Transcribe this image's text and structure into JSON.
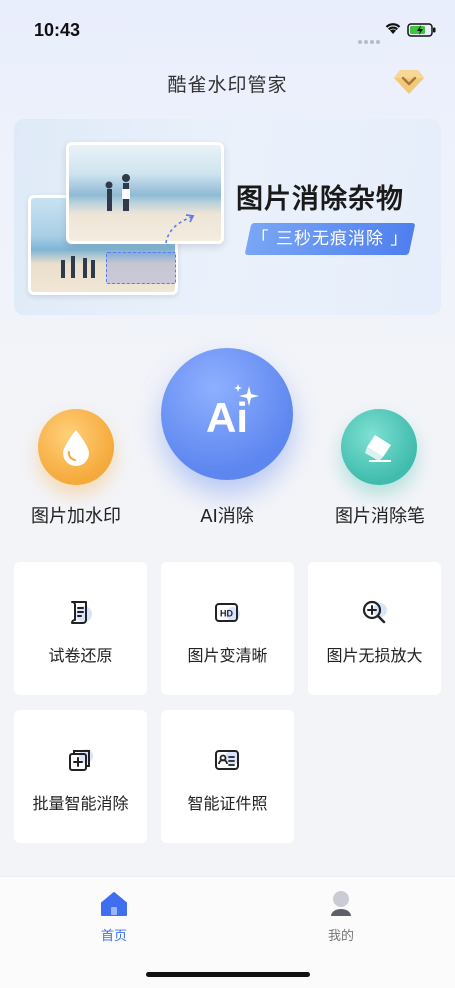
{
  "status_bar": {
    "time": "10:43"
  },
  "header": {
    "title": "酷雀水印管家",
    "vip_icon": "diamond-crown-icon"
  },
  "banner": {
    "title": "图片消除杂物",
    "subtitle": "「 三秒无痕消除 」"
  },
  "tools": [
    {
      "label": "图片加水印",
      "icon": "water-drop-icon",
      "color": "#f5a93a"
    },
    {
      "label": "AI消除",
      "icon_text": "Ai",
      "icon": "ai-sparkle-icon",
      "color": "#5d86ef"
    },
    {
      "label": "图片消除笔",
      "icon": "eraser-icon",
      "color": "#3fbcad"
    }
  ],
  "cards": [
    {
      "label": "试卷还原",
      "icon": "document-icon"
    },
    {
      "label": "图片变清晰",
      "icon": "hd-icon"
    },
    {
      "label": "图片无损放大",
      "icon": "zoom-in-icon"
    },
    {
      "label": "批量智能消除",
      "icon": "batch-add-icon"
    },
    {
      "label": "智能证件照",
      "icon": "id-card-icon"
    }
  ],
  "tab_bar": {
    "tabs": [
      {
        "label": "首页",
        "active": true,
        "color": "#3f6ef0"
      },
      {
        "label": "我的",
        "active": false,
        "color": "#777777"
      }
    ]
  }
}
